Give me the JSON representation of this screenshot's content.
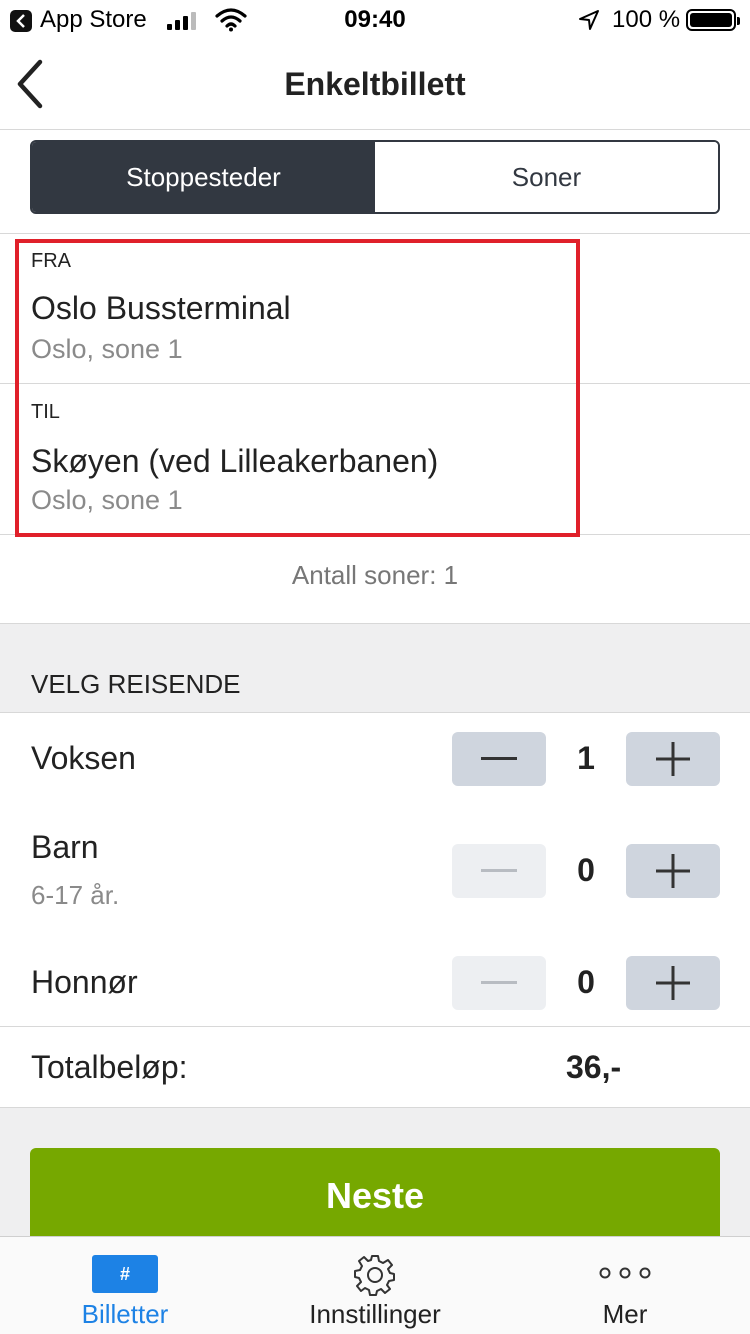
{
  "status_bar": {
    "back_app": "App Store",
    "time": "09:40",
    "battery": "100 %"
  },
  "nav": {
    "title": "Enkeltbillett"
  },
  "segment": {
    "tabs": [
      {
        "label": "Stoppesteder",
        "active": true
      },
      {
        "label": "Soner",
        "active": false
      }
    ]
  },
  "stops": {
    "from": {
      "label": "FRA",
      "name": "Oslo Bussterminal",
      "zone": "Oslo, sone 1"
    },
    "to": {
      "label": "TIL",
      "name": "Skøyen (ved Lilleakerbanen)",
      "zone": "Oslo, sone 1"
    }
  },
  "zones_count": "Antall soner: 1",
  "travellers": {
    "title": "VELG REISENDE",
    "items": [
      {
        "name": "Voksen",
        "sub": "",
        "count": "1"
      },
      {
        "name": "Barn",
        "sub": "6-17 år.",
        "count": "0"
      },
      {
        "name": "Honnør",
        "sub": "",
        "count": "0"
      }
    ]
  },
  "total": {
    "label": "Totalbeløp:",
    "value": "36,-"
  },
  "next_button": "Neste",
  "tabbar": {
    "items": [
      {
        "label": "Billetter",
        "icon": "ticket-icon",
        "badge": "#",
        "active": true
      },
      {
        "label": "Innstillinger",
        "icon": "gear-icon",
        "active": false
      },
      {
        "label": "Mer",
        "icon": "more-dots-icon",
        "active": false
      }
    ]
  },
  "colors": {
    "accent_dark": "#323841",
    "green": "#76a800",
    "blue": "#1d82e5",
    "highlight_red": "#e0202a"
  }
}
